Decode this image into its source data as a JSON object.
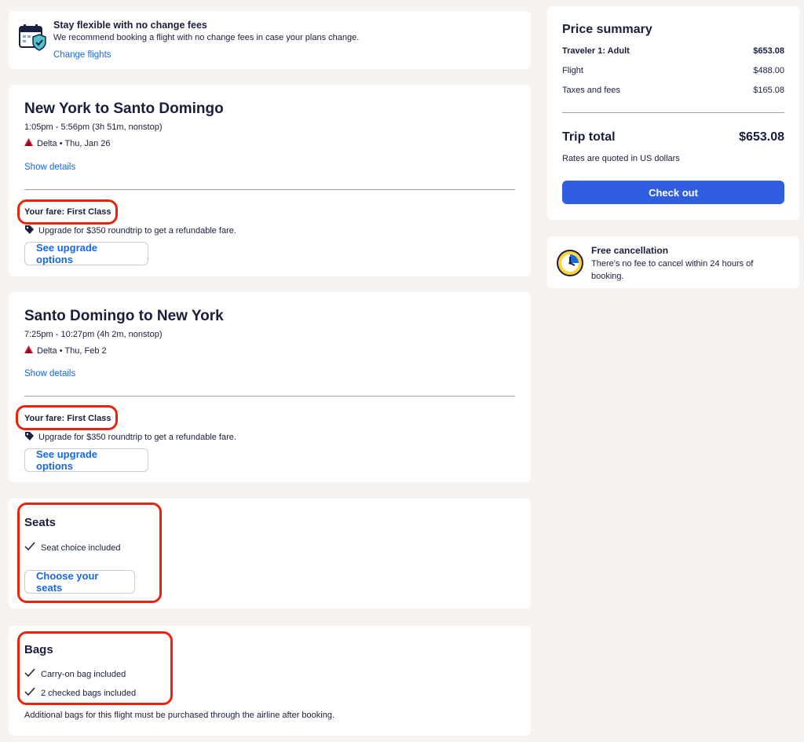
{
  "banner": {
    "title": "Stay flexible with no change fees",
    "desc": "We recommend booking a flight with no change fees in case your plans change.",
    "link": "Change flights"
  },
  "flights": [
    {
      "title": "New York to Santo Domingo",
      "times": "1:05pm - 5:56pm (3h 51m, nonstop)",
      "airline": "Delta • Thu, Jan 26",
      "show_details": "Show details",
      "fare": "Your fare: First Class",
      "upgrade": "Upgrade for $350 roundtrip to get a refundable fare.",
      "upgrade_button": "See upgrade options"
    },
    {
      "title": "Santo Domingo to New York",
      "times": "7:25pm - 10:27pm (4h 2m, nonstop)",
      "airline": "Delta • Thu, Feb 2",
      "show_details": "Show details",
      "fare": "Your fare: First Class",
      "upgrade": "Upgrade for $350 roundtrip to get a refundable fare.",
      "upgrade_button": "See upgrade options"
    }
  ],
  "seats": {
    "title": "Seats",
    "item": "Seat choice included",
    "button": "Choose your seats"
  },
  "bags": {
    "title": "Bags",
    "items": [
      "Carry-on bag included",
      "2 checked bags included"
    ],
    "note": "Additional bags for this flight must be purchased through the airline after booking."
  },
  "summary": {
    "title": "Price summary",
    "traveler_label": "Traveler 1: Adult",
    "traveler_value": "$653.08",
    "flight_label": "Flight",
    "flight_value": "$488.00",
    "taxes_label": "Taxes and fees",
    "taxes_value": "$165.08",
    "total_label": "Trip total",
    "total_value": "$653.08",
    "currency_note": "Rates are quoted in US dollars",
    "checkout": "Check out"
  },
  "cancellation": {
    "title": "Free cancellation",
    "desc": "There's no fee to cancel within 24 hours of booking."
  },
  "colors": {
    "accent": "#1668e3",
    "checkout_bg": "#2f5fe0",
    "highlight": "#e8240f",
    "page_bg": "#f5f2f0"
  }
}
